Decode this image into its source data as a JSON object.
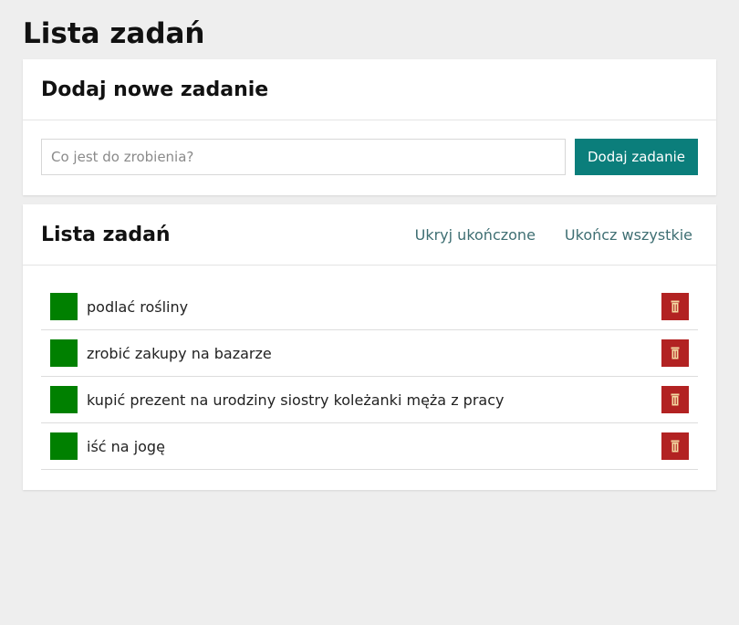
{
  "page": {
    "title": "Lista zadań"
  },
  "add_panel": {
    "title": "Dodaj nowe zadanie",
    "input_value": "",
    "input_placeholder": "Co jest do zrobienia?",
    "button_label": "Dodaj zadanie"
  },
  "list_panel": {
    "title": "Lista zadań",
    "hide_completed_label": "Ukryj ukończone",
    "complete_all_label": "Ukończ wszystkie",
    "tasks": [
      {
        "text": "podlać rośliny",
        "checkbox_color": "#008000",
        "delete_icon": "trash-icon"
      },
      {
        "text": "zrobić zakupy na bazarze",
        "checkbox_color": "#008000",
        "delete_icon": "trash-icon"
      },
      {
        "text": "kupić prezent na urodziny siostry koleżanki męża z pracy",
        "checkbox_color": "#008000",
        "delete_icon": "trash-icon"
      },
      {
        "text": "iść na jogę",
        "checkbox_color": "#008000",
        "delete_icon": "trash-icon"
      }
    ]
  },
  "colors": {
    "background": "#eeeeee",
    "accent": "#0b7e7b",
    "link": "#3f6f73",
    "checkbox": "#008000",
    "delete": "#b22222"
  }
}
